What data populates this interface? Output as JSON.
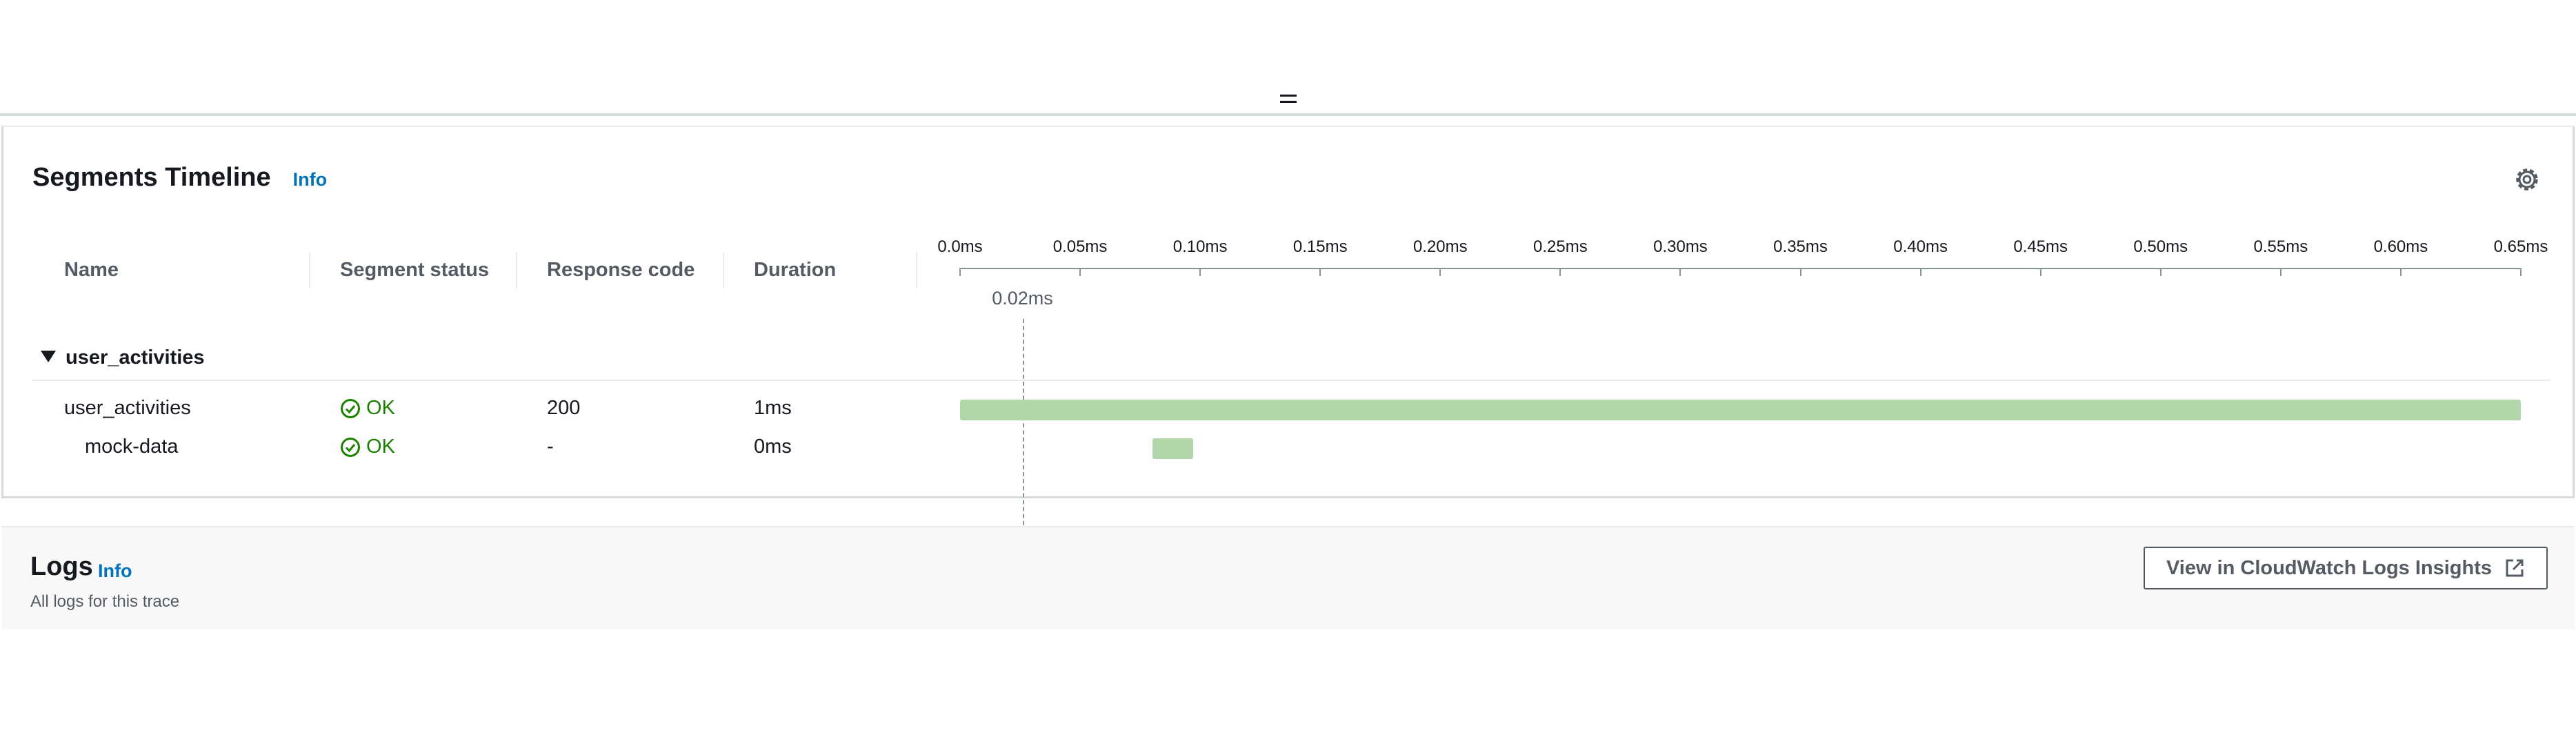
{
  "timeline": {
    "title": "Segments Timeline",
    "info_label": "Info",
    "columns": {
      "name": "Name",
      "segment_status": "Segment status",
      "response_code": "Response code",
      "duration": "Duration"
    },
    "axis_ticks": [
      "0.0ms",
      "0.05ms",
      "0.10ms",
      "0.15ms",
      "0.20ms",
      "0.25ms",
      "0.30ms",
      "0.35ms",
      "0.40ms",
      "0.45ms",
      "0.50ms",
      "0.55ms",
      "0.60ms",
      "0.65ms"
    ],
    "axis_max_ms": 0.65,
    "marker_label": "0.02ms",
    "marker_ms": 0.026,
    "group": {
      "name": "user_activities",
      "expanded": true
    },
    "segments": [
      {
        "name": "user_activities",
        "status": "OK",
        "response_code": "200",
        "duration": "1ms",
        "start_ms": 0.0,
        "end_ms": 0.65
      },
      {
        "name": "mock-data",
        "status": "OK",
        "response_code": "-",
        "duration": "0ms",
        "start_ms": 0.08,
        "end_ms": 0.097
      }
    ],
    "bar_color": "#b2d5aa",
    "status_ok_color": "#1d8102"
  },
  "logs": {
    "title": "Logs",
    "info_label": "Info",
    "subtitle": "All logs for this trace",
    "cloudwatch_button": "View in CloudWatch Logs Insights"
  },
  "icons": {
    "settings": "gear-icon",
    "external": "external-link-icon",
    "status": "check-circle-icon",
    "toggle": "caret-down-icon",
    "resize": "drag-handle-icon"
  },
  "accent_color": "#0073bb"
}
